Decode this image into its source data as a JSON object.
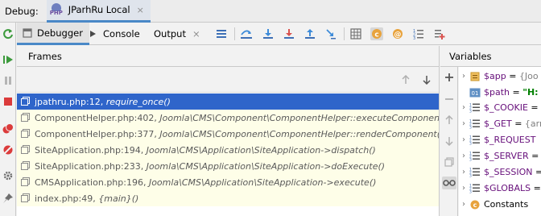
{
  "titlebar": {
    "debug_label": "Debug:",
    "session_name": "JParhRu Local",
    "session_icon_text": "PHP",
    "close_glyph": "×"
  },
  "tabs": [
    {
      "label": "Debugger",
      "icon": "debugger-icon"
    },
    {
      "label": "Console",
      "icon": "console-icon"
    },
    {
      "label": "Output",
      "icon": ""
    }
  ],
  "tab_close_glyph": "×",
  "frames": {
    "title": "Frames",
    "rows": [
      {
        "location": "jpathru.php:12, ",
        "method": "require_once()"
      },
      {
        "location": "ComponentHelper.php:402, ",
        "method": "Joomla\\CMS\\Component\\ComponentHelper::executeComponent()"
      },
      {
        "location": "ComponentHelper.php:377, ",
        "method": "Joomla\\CMS\\Component\\ComponentHelper::renderComponent()"
      },
      {
        "location": "SiteApplication.php:194, ",
        "method": "Joomla\\CMS\\Application\\SiteApplication->dispatch()"
      },
      {
        "location": "SiteApplication.php:233, ",
        "method": "Joomla\\CMS\\Application\\SiteApplication->doExecute()"
      },
      {
        "location": "CMSApplication.php:196, ",
        "method": "Joomla\\CMS\\Application\\SiteApplication->execute()"
      },
      {
        "location": "index.php:49, ",
        "method": "{main}()"
      }
    ],
    "selected_index": 0
  },
  "variables": {
    "title": "Variables",
    "rows": [
      {
        "name": "$app",
        "eq": " = ",
        "value": "{Joo",
        "kind": "object",
        "expandable": true
      },
      {
        "name": "$path",
        "eq": " = ",
        "value": "\"H:",
        "kind": "string",
        "expandable": false
      },
      {
        "name": "$_COOKIE",
        "eq": " = ",
        "value": "",
        "kind": "array",
        "expandable": true
      },
      {
        "name": "$_GET",
        "eq": " = ",
        "value": "{arr",
        "kind": "array",
        "expandable": true
      },
      {
        "name": "$_REQUEST",
        "eq": "",
        "value": "",
        "kind": "array",
        "expandable": true
      },
      {
        "name": "$_SERVER",
        "eq": " = ",
        "value": "",
        "kind": "array",
        "expandable": true
      },
      {
        "name": "$_SESSION",
        "eq": " = ",
        "value": "",
        "kind": "array",
        "expandable": true
      },
      {
        "name": "$GLOBALS",
        "eq": " = ",
        "value": "",
        "kind": "array",
        "expandable": true
      },
      {
        "name": "Constants",
        "eq": "",
        "value": "",
        "kind": "constant",
        "expandable": true
      }
    ]
  },
  "colors": {
    "selection": "#2f65ca",
    "frame_bg": "#fefee8",
    "var_name": "#660e7a",
    "accent": "#4a88c7"
  }
}
